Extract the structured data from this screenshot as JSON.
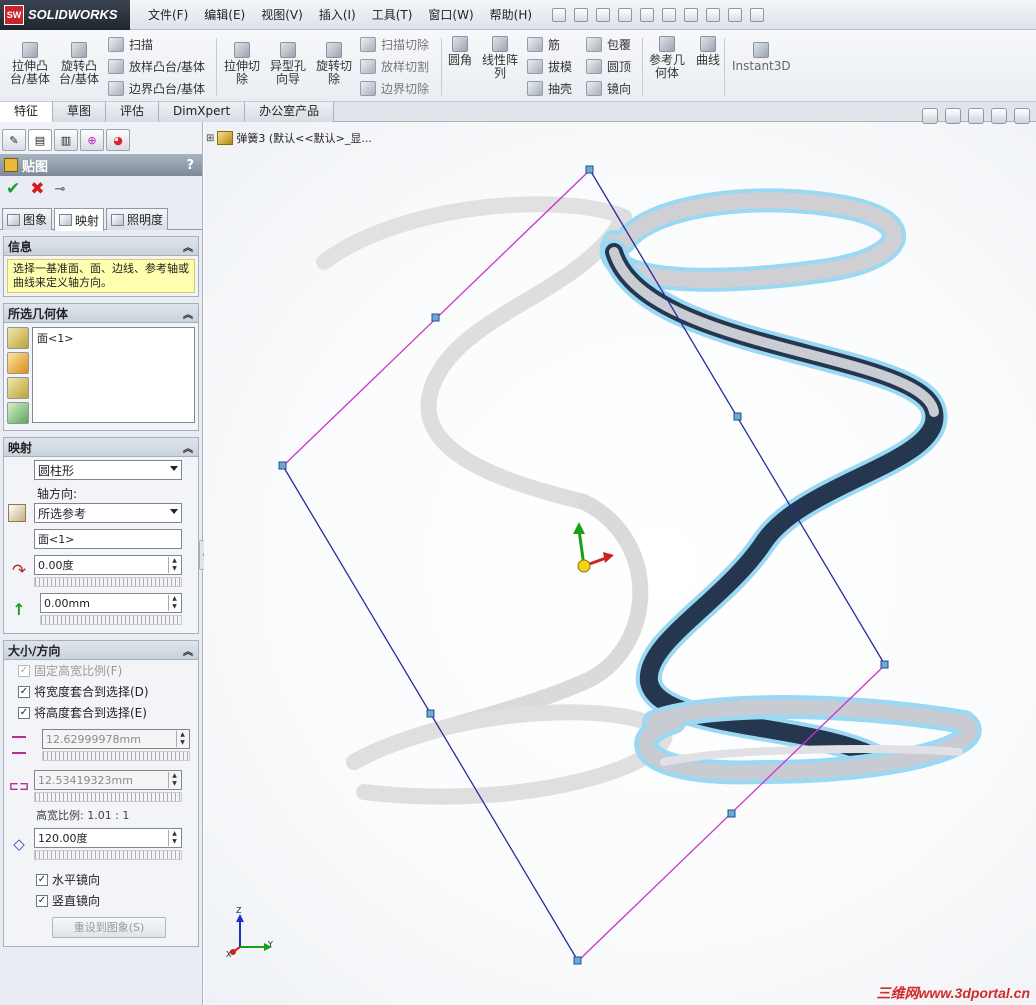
{
  "app": {
    "logo_mark": "SW",
    "logo_text": "SOLIDWORKS"
  },
  "menu": [
    "文件(F)",
    "编辑(E)",
    "视图(V)",
    "插入(I)",
    "工具(T)",
    "窗口(W)",
    "帮助(H)"
  ],
  "commands": {
    "extrude_boss": "拉伸凸\n台/基体",
    "revolve_boss": "旋转凸\n台/基体",
    "sweep": "扫描",
    "loft": "放样凸台/基体",
    "boundary_boss": "边界凸台/基体",
    "extrude_cut": "拉伸切\n除",
    "hole_wizard": "异型孔\n向导",
    "revolve_cut": "旋转切\n除",
    "swept_cut": "扫描切除",
    "loft_cut": "放样切割",
    "boundary_cut": "边界切除",
    "fillet": "圆角",
    "linear_pattern": "线性阵\n列",
    "rib": "筋",
    "draft": "拔模",
    "shell": "抽壳",
    "wrap": "包覆",
    "dome": "圆顶",
    "mirror": "镜向",
    "ref_geometry": "参考几\n何体",
    "curves": "曲线",
    "instant3d": "Instant3D"
  },
  "tabs": [
    "特征",
    "草图",
    "评估",
    "DimXpert",
    "办公室产品"
  ],
  "panel": {
    "title": "贴图",
    "help": "?",
    "subtabs": [
      "图象",
      "映射",
      "照明度"
    ],
    "info": {
      "header": "信息",
      "text": "选择一基准面、面、边线、参考轴或曲线来定义轴方向。"
    },
    "selected_geometry": {
      "header": "所选几何体",
      "items": [
        "面<1>"
      ]
    },
    "mapping": {
      "header": "映射",
      "type": "圆柱形",
      "axis_label": "轴方向:",
      "axis_value": "所选参考",
      "axis_ref": "面<1>",
      "rotation": "0.00度",
      "offset": "0.00mm"
    },
    "size": {
      "header": "大小/方向",
      "fixed_ratio": "固定高宽比例(F)",
      "fit_width": "将宽度套合到选择(D)",
      "fit_height": "将高度套合到选择(E)",
      "height": "12.62999978mm",
      "width": "12.53419323mm",
      "ratio": "高宽比例: 1.01 : 1",
      "angle": "120.00度",
      "mirror_h": "水平镜向",
      "mirror_v": "竖直镜向",
      "reset": "重设到图象(S)"
    }
  },
  "tree": {
    "label": "弹簧3  (默认<<默认>_显..."
  },
  "triad": {
    "z": "Z",
    "y": "Y",
    "x": "X"
  },
  "watermark": "三维网www.3dportal.cn",
  "colors": {
    "accent_red": "#c8262c",
    "info_yellow": "#ffffb0",
    "selection_blue": "#3b6fe0"
  }
}
